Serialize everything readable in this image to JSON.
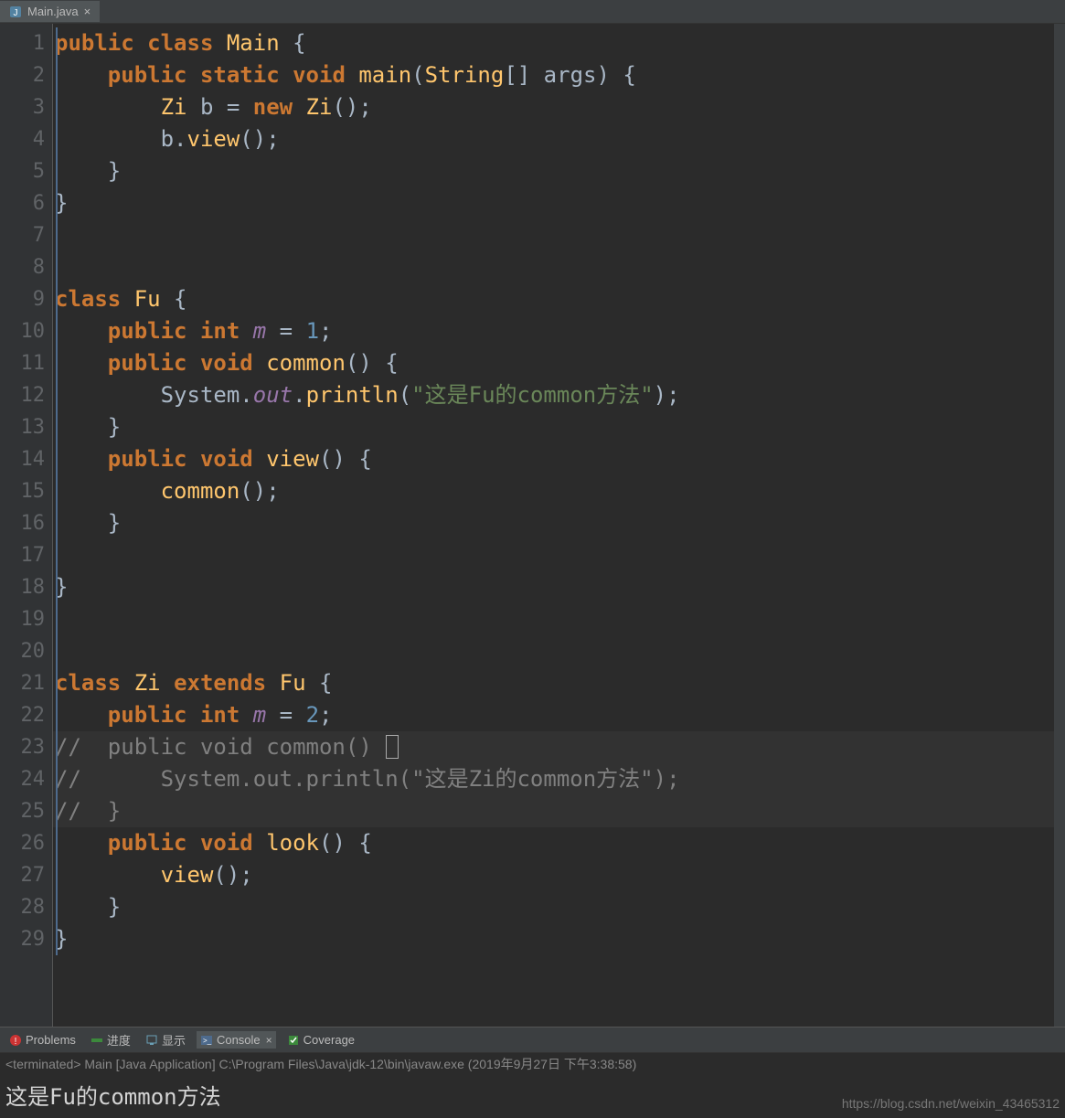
{
  "tab": {
    "filename": "Main.java",
    "icon": "java-file-icon"
  },
  "lineNumbers": [
    1,
    2,
    3,
    4,
    5,
    6,
    7,
    8,
    9,
    10,
    11,
    12,
    13,
    14,
    15,
    16,
    17,
    18,
    19,
    20,
    21,
    22,
    23,
    24,
    25,
    26,
    27,
    28,
    29
  ],
  "code": [
    [
      {
        "c": "kw",
        "t": "public "
      },
      {
        "c": "kw",
        "t": "class "
      },
      {
        "c": "type",
        "t": "Main"
      },
      {
        "c": "paren",
        "t": " {"
      }
    ],
    [
      {
        "c": "id",
        "t": "    "
      },
      {
        "c": "kw",
        "t": "public "
      },
      {
        "c": "kw",
        "t": "static "
      },
      {
        "c": "kw",
        "t": "void "
      },
      {
        "c": "meth",
        "t": "main"
      },
      {
        "c": "paren",
        "t": "("
      },
      {
        "c": "type",
        "t": "String"
      },
      {
        "c": "paren",
        "t": "[] "
      },
      {
        "c": "id",
        "t": "args"
      },
      {
        "c": "paren",
        "t": ") {"
      }
    ],
    [
      {
        "c": "id",
        "t": "        "
      },
      {
        "c": "type",
        "t": "Zi"
      },
      {
        "c": "id",
        "t": " b = "
      },
      {
        "c": "kw",
        "t": "new "
      },
      {
        "c": "type",
        "t": "Zi"
      },
      {
        "c": "paren",
        "t": "();"
      }
    ],
    [
      {
        "c": "id",
        "t": "        b."
      },
      {
        "c": "meth",
        "t": "view"
      },
      {
        "c": "paren",
        "t": "();"
      }
    ],
    [
      {
        "c": "paren",
        "t": "    }"
      }
    ],
    [
      {
        "c": "paren",
        "t": "}"
      }
    ],
    [
      {
        "c": "id",
        "t": ""
      }
    ],
    [
      {
        "c": "id",
        "t": ""
      }
    ],
    [
      {
        "c": "kw",
        "t": "class "
      },
      {
        "c": "type",
        "t": "Fu"
      },
      {
        "c": "paren",
        "t": " {"
      }
    ],
    [
      {
        "c": "id",
        "t": "    "
      },
      {
        "c": "kw",
        "t": "public "
      },
      {
        "c": "kw",
        "t": "int "
      },
      {
        "c": "fld",
        "t": "m"
      },
      {
        "c": "id",
        "t": " = "
      },
      {
        "c": "num",
        "t": "1"
      },
      {
        "c": "paren",
        "t": ";"
      }
    ],
    [
      {
        "c": "id",
        "t": "    "
      },
      {
        "c": "kw",
        "t": "public "
      },
      {
        "c": "kw",
        "t": "void "
      },
      {
        "c": "meth",
        "t": "common"
      },
      {
        "c": "paren",
        "t": "() {"
      }
    ],
    [
      {
        "c": "id",
        "t": "        "
      },
      {
        "c": "cls",
        "t": "System"
      },
      {
        "c": "id",
        "t": "."
      },
      {
        "c": "fld",
        "t": "out"
      },
      {
        "c": "id",
        "t": "."
      },
      {
        "c": "meth",
        "t": "println"
      },
      {
        "c": "paren",
        "t": "("
      },
      {
        "c": "str",
        "t": "\"这是Fu的common方法\""
      },
      {
        "c": "paren",
        "t": ");"
      }
    ],
    [
      {
        "c": "paren",
        "t": "    }"
      }
    ],
    [
      {
        "c": "id",
        "t": "    "
      },
      {
        "c": "kw",
        "t": "public "
      },
      {
        "c": "kw",
        "t": "void "
      },
      {
        "c": "meth",
        "t": "view"
      },
      {
        "c": "paren",
        "t": "() {"
      }
    ],
    [
      {
        "c": "id",
        "t": "        "
      },
      {
        "c": "meth",
        "t": "common"
      },
      {
        "c": "paren",
        "t": "();"
      }
    ],
    [
      {
        "c": "paren",
        "t": "    }"
      }
    ],
    [
      {
        "c": "id",
        "t": ""
      }
    ],
    [
      {
        "c": "paren",
        "t": "}"
      }
    ],
    [
      {
        "c": "id",
        "t": ""
      }
    ],
    [
      {
        "c": "id",
        "t": ""
      }
    ],
    [
      {
        "c": "kw",
        "t": "class "
      },
      {
        "c": "type",
        "t": "Zi"
      },
      {
        "c": "id",
        "t": " "
      },
      {
        "c": "kw",
        "t": "extends "
      },
      {
        "c": "type",
        "t": "Fu"
      },
      {
        "c": "paren",
        "t": " {"
      }
    ],
    [
      {
        "c": "id",
        "t": "    "
      },
      {
        "c": "kw",
        "t": "public "
      },
      {
        "c": "kw",
        "t": "int "
      },
      {
        "c": "fld",
        "t": "m"
      },
      {
        "c": "id",
        "t": " = "
      },
      {
        "c": "num",
        "t": "2"
      },
      {
        "c": "paren",
        "t": ";"
      }
    ],
    [
      {
        "c": "com",
        "t": "//  public void common() "
      },
      {
        "c": "cursor",
        "t": "{"
      }
    ],
    [
      {
        "c": "com",
        "t": "//      System.out.println(\"这是Zi的common方法\");"
      }
    ],
    [
      {
        "c": "com",
        "t": "//  }"
      }
    ],
    [
      {
        "c": "id",
        "t": "    "
      },
      {
        "c": "kw",
        "t": "public "
      },
      {
        "c": "kw",
        "t": "void "
      },
      {
        "c": "meth",
        "t": "look"
      },
      {
        "c": "paren",
        "t": "() {"
      }
    ],
    [
      {
        "c": "id",
        "t": "        "
      },
      {
        "c": "meth",
        "t": "view"
      },
      {
        "c": "paren",
        "t": "();"
      }
    ],
    [
      {
        "c": "paren",
        "t": "    }"
      }
    ],
    [
      {
        "c": "paren",
        "t": "}"
      }
    ]
  ],
  "highlightedLines": [
    23,
    24,
    25
  ],
  "panelTabs": [
    {
      "label": "Problems",
      "icon": "problems-icon",
      "closable": false,
      "active": false
    },
    {
      "label": "进度",
      "icon": "progress-icon",
      "closable": false,
      "active": false
    },
    {
      "label": "显示",
      "icon": "display-icon",
      "closable": false,
      "active": false
    },
    {
      "label": "Console",
      "icon": "console-icon",
      "closable": true,
      "active": true
    },
    {
      "label": "Coverage",
      "icon": "coverage-icon",
      "closable": false,
      "active": false
    }
  ],
  "console": {
    "header": "<terminated> Main [Java Application] C:\\Program Files\\Java\\jdk-12\\bin\\javaw.exe (2019年9月27日 下午3:38:58)",
    "output": "这是Fu的common方法"
  },
  "watermark": "https://blog.csdn.net/weixin_43465312"
}
